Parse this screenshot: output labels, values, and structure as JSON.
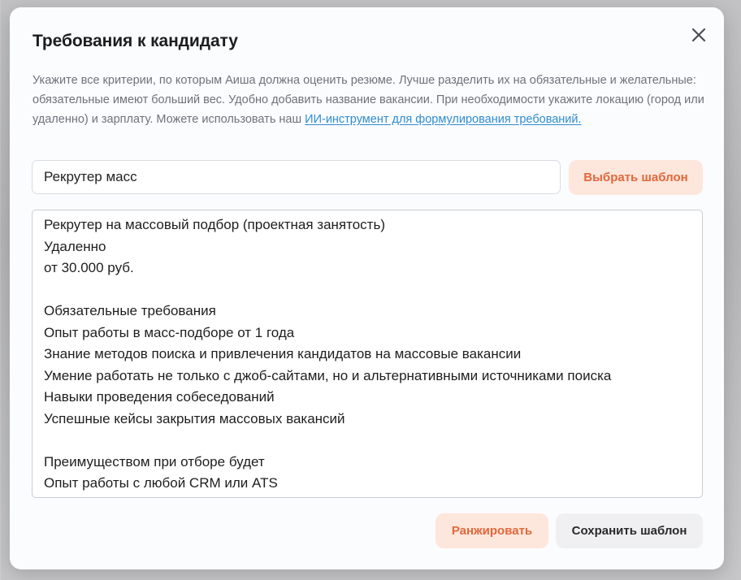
{
  "modal": {
    "title": "Требования к кандидату",
    "description_text": "Укажите все критерии, по которым Аиша должна оценить резюме. Лучше разделить их на обязательные и желательные: обязательные имеют больший вес. Удобно добавить название вакансии. При необходимости укажите локацию (город или удаленно) и зарплату. Можете использовать наш ",
    "description_link": "ИИ-инструмент для формулирования требований.",
    "close_icon": "close-icon",
    "template_name_value": "Рекрутер масс",
    "choose_template_label": "Выбрать шаблон",
    "requirements_lines": [
      "Рекрутер на массовый подбор (проектная занятость)",
      "Удаленно",
      "от 30.000 руб.",
      "",
      "Обязательные требования",
      "Опыт работы в масс-подборе от 1 года",
      "Знание методов поиска и привлечения кандидатов на массовые вакансии",
      "Умение работать не только с джоб-сайтами, но и альтернативными источниками поиска",
      "Навыки проведения собеседований",
      "Успешные кейсы закрытия массовых вакансий",
      "",
      "Преимуществом при отборе будет",
      "Опыт работы с любой CRM или ATS"
    ],
    "rank_label": "Ранжировать",
    "save_template_label": "Сохранить шаблон"
  },
  "colors": {
    "accent_text": "#e2683a",
    "accent_bg": "#fde6dc",
    "link": "#2f8ccf"
  }
}
